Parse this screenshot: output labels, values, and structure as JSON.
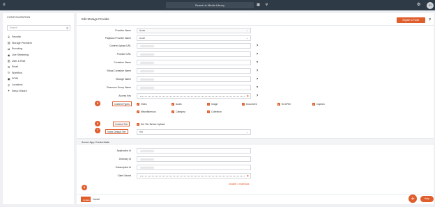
{
  "topbar": {
    "menu_icon": "hamburger-icon",
    "search_placeholder": "Search in Media Library",
    "avatar_initials": "SY"
  },
  "sidebar": {
    "title": "CONFIGURATION",
    "search_placeholder": "Search",
    "items": [
      {
        "label": "Security",
        "icon": "lock-icon"
      },
      {
        "label": "Storage Providers",
        "icon": "storage-icon"
      },
      {
        "label": "Encoding",
        "icon": "swap-icon"
      },
      {
        "label": "Live Streaming",
        "icon": "broadcast-icon"
      },
      {
        "label": "User & Role",
        "icon": "users-icon"
      },
      {
        "label": "Email",
        "icon": "mail-icon"
      },
      {
        "label": "Workflow",
        "icon": "workflow-icon"
      },
      {
        "label": "SCIM",
        "icon": "id-icon"
      },
      {
        "label": "Locations",
        "icon": "pin-icon"
      },
      {
        "label": "Setup Wizard",
        "icon": "wizard-icon"
      }
    ]
  },
  "main": {
    "title": "Edit Storage Provider",
    "migrate_label": "Migrate to Folder",
    "fields": {
      "provider_name": {
        "label": "Provider Name",
        "value": "Azure"
      },
      "playback_provider_name": {
        "label": "Playback Provider Name",
        "value": "Azure"
      },
      "content_upload_url": {
        "label": "Content Upload URL"
      },
      "provider_url": {
        "label": "Provider URL"
      },
      "container_name": {
        "label": "Container Name"
      },
      "virtual_container_name": {
        "label": "Virtual Container Name"
      },
      "storage_name": {
        "label": "Storage Name"
      },
      "resource_group_name": {
        "label": "Resource Group Name"
      },
      "access_key": {
        "label": "Access Key"
      }
    },
    "content_types": {
      "label": "Content Types",
      "step": "5",
      "items": [
        "Video",
        "Audio",
        "Image",
        "Document",
        "SCORM",
        "Caption",
        "Miscellaneous",
        "Category",
        "Collection"
      ]
    },
    "content_tier": {
      "label": "Content Tier",
      "step": "6",
      "checkbox_label": "Set Tier Before Upload"
    },
    "index_default_tier": {
      "label": "Index Default Tier",
      "step": "7",
      "value": "Hot"
    },
    "azure_section": {
      "title": "Azure App Credentials",
      "fields": {
        "application_id": {
          "label": "Application Id"
        },
        "directory_id": {
          "label": "Directory Id"
        },
        "subscription_id": {
          "label": "Subscription Id"
        },
        "client_secret": {
          "label": "Client Secret"
        }
      },
      "disable_link": "Disable Credentials"
    }
  },
  "footer": {
    "update_label": "Update",
    "cancel_label": "Cancel",
    "step": "8"
  },
  "floating": {
    "add_label": "+",
    "help_label": "Help"
  },
  "colors": {
    "accent": "#e05d2c",
    "topbar": "#2e3a46"
  }
}
